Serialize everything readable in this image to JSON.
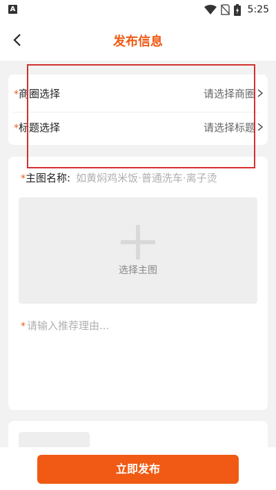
{
  "status_bar": {
    "left_icon": "A",
    "time": "5:25",
    "icons": [
      "wifi-icon",
      "no-sim-icon",
      "battery-charging-icon"
    ]
  },
  "nav": {
    "back_icon": "chevron-left-icon",
    "title": "发布信息"
  },
  "selectors": [
    {
      "label": "商圈选择",
      "value": "请选择商圈"
    },
    {
      "label": "标题选择",
      "value": "请选择标题"
    }
  ],
  "required_mark": "*",
  "main_image": {
    "name_label": "主图名称:",
    "name_placeholder": "如黄焖鸡米饭·普通洗车·离子烫",
    "upload_label": "选择主图"
  },
  "reason": {
    "placeholder": "请输入推荐理由..."
  },
  "actions": {
    "publish_label": "立即发布"
  },
  "colors": {
    "accent": "#f05a14",
    "background": "#f2f2f2",
    "annotation": "#d32f2f"
  }
}
